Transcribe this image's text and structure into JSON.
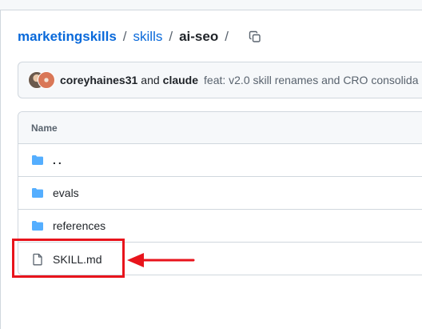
{
  "breadcrumb": {
    "repo": "marketingskills",
    "folder": "skills",
    "current": "ai-seo",
    "separator": "/"
  },
  "commit": {
    "author_primary": "coreyhaines31",
    "and_text": "and",
    "author_secondary": "claude",
    "message": "feat: v2.0 skill renames and CRO consolida"
  },
  "table": {
    "header": "Name",
    "rows": [
      {
        "name": "..",
        "icon": "folder-icon"
      },
      {
        "name": "evals",
        "icon": "folder-icon"
      },
      {
        "name": "references",
        "icon": "folder-icon"
      },
      {
        "name": "SKILL.md",
        "icon": "file-icon"
      }
    ]
  },
  "colors": {
    "link": "#0969da",
    "folder": "#54aeff",
    "annotation": "#e8141c"
  },
  "icons": {
    "copy": "copy-icon",
    "folder": "folder-icon",
    "file": "file-icon",
    "arrow": "arrow-left-icon"
  }
}
